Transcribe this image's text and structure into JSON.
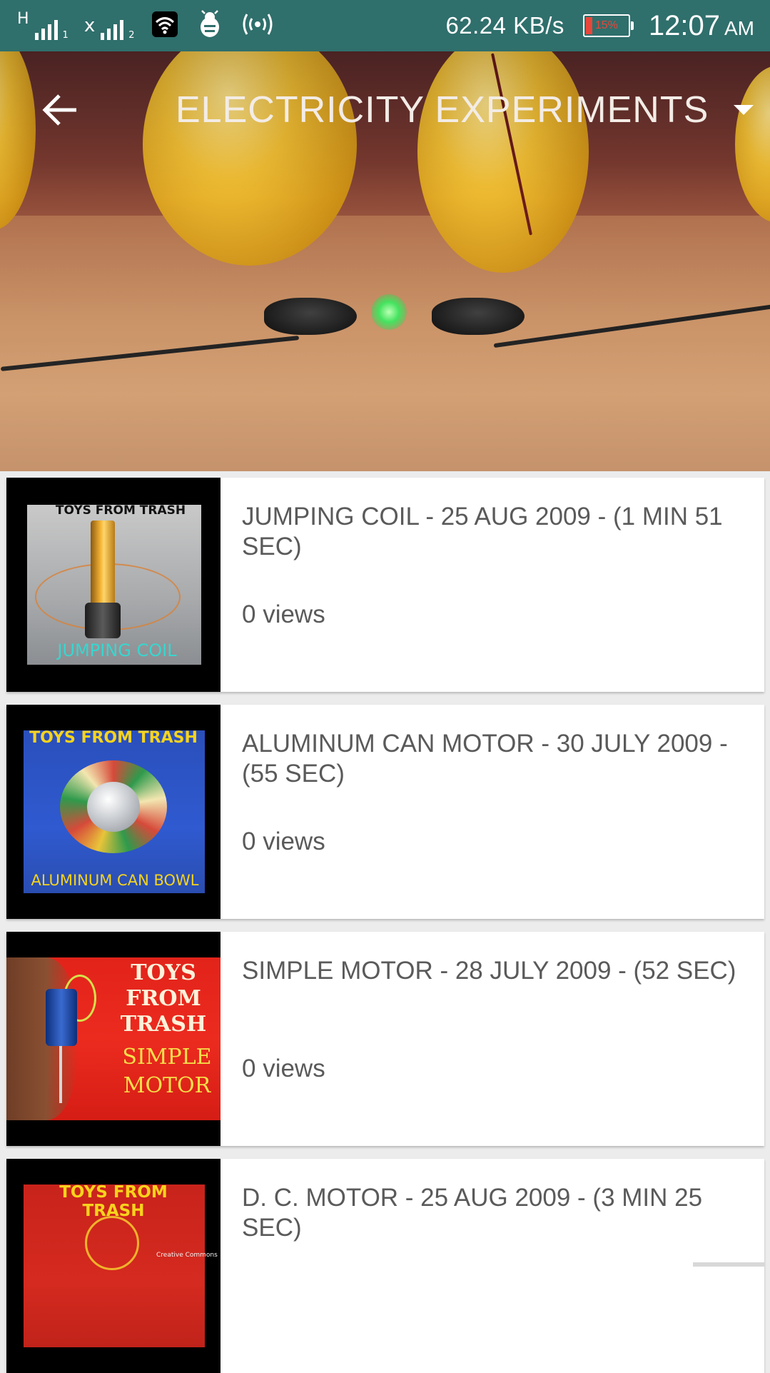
{
  "status_bar": {
    "network_type": "H",
    "sim1_index": "1",
    "sim2_prefix": "x",
    "sim2_index": "2",
    "speed": "62.24 KB/s",
    "battery": "15%",
    "time": "12:07",
    "ampm": "AM",
    "icons": [
      "wifi-icon",
      "bug-icon",
      "hotspot-icon"
    ]
  },
  "header": {
    "title": "ELECTRICITY EXPERIMENTS",
    "back_icon": "arrow-left-icon",
    "dropdown_icon": "triangle-down-icon"
  },
  "videos": [
    {
      "title": "JUMPING COIL - 25 AUG 2009 - (1 MIN 51 SEC)",
      "views": "0 views",
      "thumb_top": "TOYS FROM TRASH",
      "thumb_label": "JUMPING COIL"
    },
    {
      "title": "ALUMINUM CAN MOTOR - 30 JULY 2009 - (55 SEC)",
      "views": "0 views",
      "thumb_top": "TOYS FROM TRASH",
      "thumb_label": "ALUMINUM CAN BOWL"
    },
    {
      "title": "SIMPLE MOTOR - 28 JULY 2009 - (52 SEC)",
      "views": "0 views",
      "thumb_top": "TOYS FROM TRASH",
      "thumb_label": "SIMPLE MOTOR"
    },
    {
      "title": "D. C. MOTOR - 25 AUG 2009 - (3 MIN 25 SEC)",
      "views": "",
      "thumb_top": "TOYS FROM TRASH",
      "thumb_small": "Creative Commons"
    }
  ],
  "colors": {
    "status_bar": "#2f6f6c",
    "title_text": "#f3ece6",
    "card_text": "#5a5a5a",
    "background": "#ececec"
  }
}
